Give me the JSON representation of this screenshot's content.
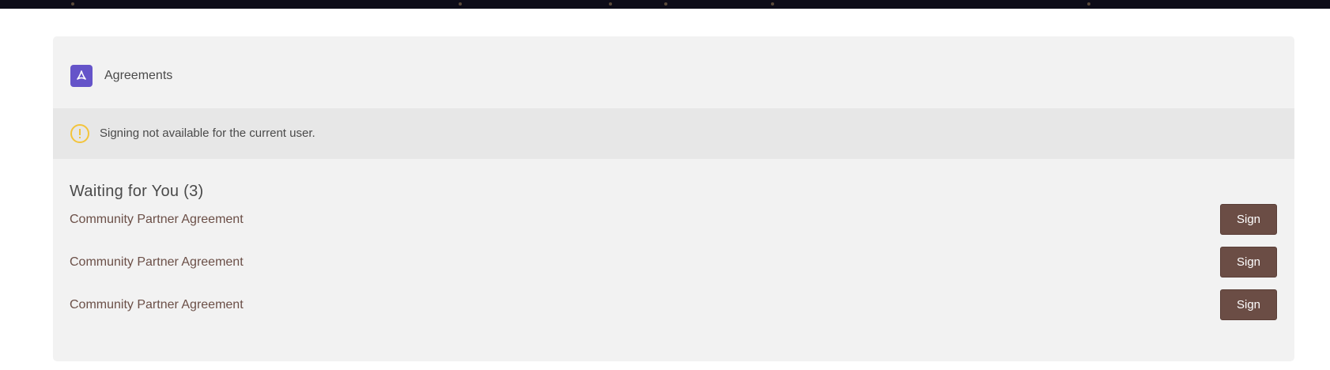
{
  "card": {
    "title": "Agreements",
    "icon": "pdf-icon",
    "icon_color": "#6554c9"
  },
  "notice": {
    "icon": "warning-circle-icon",
    "icon_color": "#f3c43b",
    "text": "Signing not available for the current user."
  },
  "section": {
    "title": "Waiting for You (3)"
  },
  "documents": [
    {
      "name": "Community Partner Agreement",
      "action_label": "Sign"
    },
    {
      "name": "Community Partner Agreement",
      "action_label": "Sign"
    },
    {
      "name": "Community Partner Agreement",
      "action_label": "Sign"
    }
  ],
  "colors": {
    "button_bg": "#6b4d45",
    "link_text": "#6b4f47",
    "card_bg": "#f2f2f2",
    "notice_bg": "#e7e7e7"
  }
}
